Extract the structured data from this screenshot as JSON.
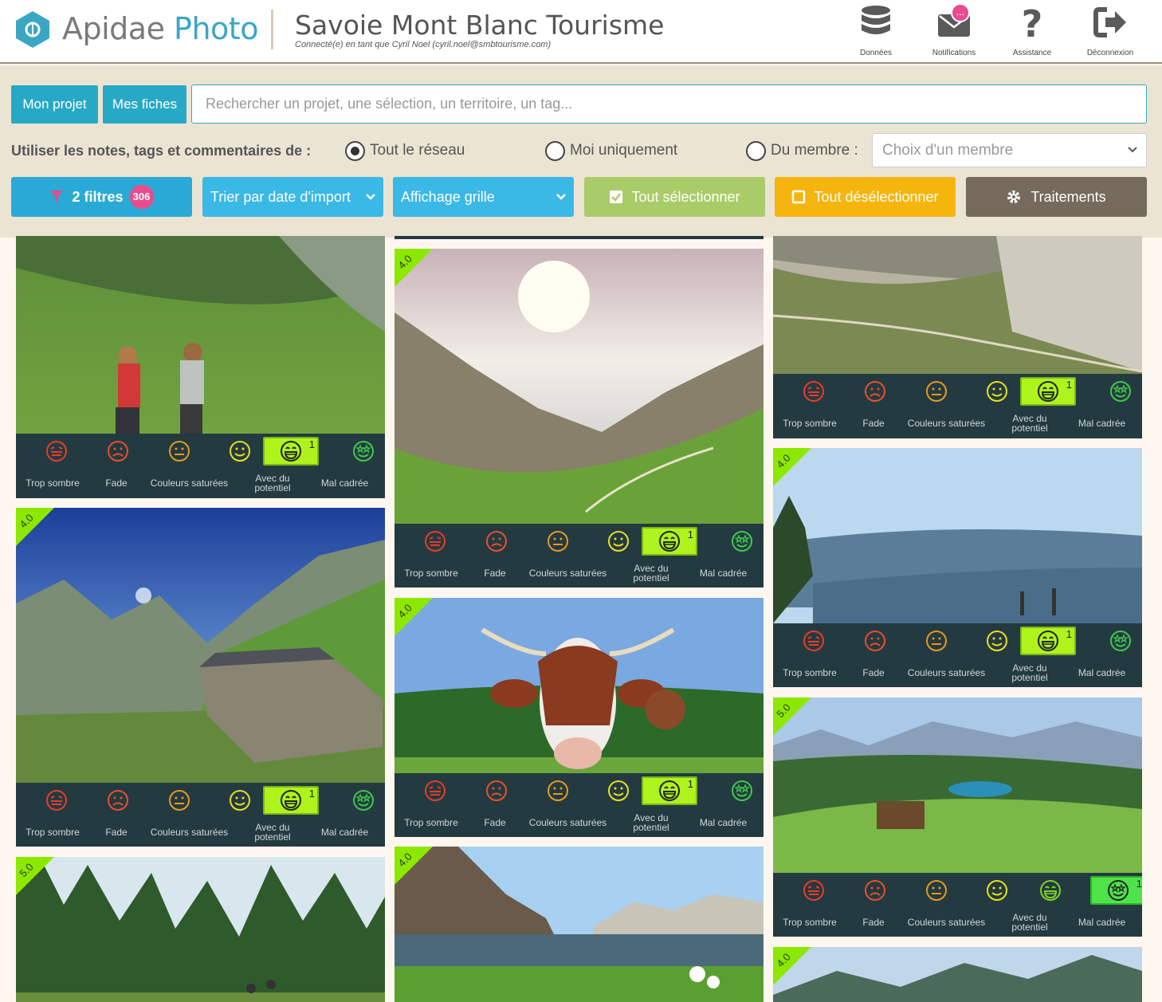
{
  "header": {
    "brand_main": "Apidae",
    "brand_accent": " Photo",
    "org_title": "Savoie Mont Blanc Tourisme",
    "connected_as": "Connecté(e) en tant que Cyril Noel (cyril.noel@smbtourisme.com)",
    "actions": [
      {
        "label": "Données",
        "icon": "database-icon"
      },
      {
        "label": "Notifications",
        "icon": "envelope-icon",
        "badge": "..."
      },
      {
        "label": "Assistance",
        "icon": "question-icon"
      },
      {
        "label": "Déconnexion",
        "icon": "sign-out-icon"
      }
    ]
  },
  "toolbar": {
    "mon_projet": "Mon projet",
    "mes_fiches": "Mes fiches",
    "search_placeholder": "Rechercher un projet, une sélection, un territoire, un tag...",
    "use_label": "Utiliser les notes, tags et commentaires de :",
    "radio_options": [
      {
        "label": "Tout le réseau",
        "checked": true
      },
      {
        "label": "Moi uniquement",
        "checked": false
      },
      {
        "label": "Du membre :",
        "checked": false
      }
    ],
    "member_placeholder": "Choix d'un membre",
    "filters_label": "2 filtres",
    "filters_count": "306",
    "sort_label": "Trier par date d'import",
    "display_label": "Affichage grille",
    "select_all": "Tout sélectionner",
    "deselect_all": "Tout désélectionner",
    "treatments": "Traitements"
  },
  "tags": [
    "Trop sombre",
    "Fade",
    "Couleurs saturées",
    "Avec du potentiel",
    "Mal cadrée"
  ],
  "tag_colors": [
    "#e83c2a",
    "#e8502a",
    "#e59a1c",
    "#e8e01c",
    "#7ed320",
    "#3fc94a"
  ],
  "cards": [
    {
      "rating": "",
      "selected": 4,
      "count": "1",
      "scene": "hikers"
    },
    {
      "rating": "4.0",
      "selected": 4,
      "count": "1",
      "scene": "refuge"
    },
    {
      "rating": "5.0",
      "selected": -1,
      "count": "",
      "scene": "forest"
    },
    {
      "rating": "4.0",
      "selected": 4,
      "count": "1",
      "scene": "valley"
    },
    {
      "rating": "4.0",
      "selected": 4,
      "count": "1",
      "scene": "cow"
    },
    {
      "rating": "4.0",
      "selected": -1,
      "count": "",
      "scene": "lake"
    },
    {
      "rating": "",
      "selected": 4,
      "count": "1",
      "scene": "trail"
    },
    {
      "rating": "4.0",
      "selected": 4,
      "count": "1",
      "scene": "mistlake"
    },
    {
      "rating": "5.0",
      "selected": 5,
      "count": "1",
      "scene": "chalet"
    },
    {
      "rating": "4.0",
      "selected": -1,
      "count": "",
      "scene": "peaks"
    }
  ]
}
